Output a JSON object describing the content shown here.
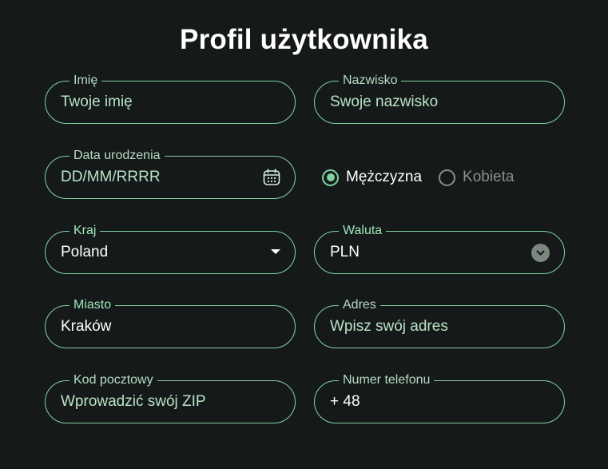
{
  "header": {
    "title": "Profil użytkownika"
  },
  "fields": {
    "first_name": {
      "label": "Imię",
      "placeholder": "Twoje imię"
    },
    "last_name": {
      "label": "Nazwisko",
      "placeholder": "Swoje nazwisko"
    },
    "birth_date": {
      "label": "Data urodzenia",
      "placeholder": "DD/MM/RRRR",
      "icon": "calendar-icon"
    },
    "country": {
      "label": "Kraj",
      "value": "Poland",
      "icon": "caret-down-icon"
    },
    "currency": {
      "label": "Waluta",
      "value": "PLN",
      "icon": "chevron-down-circle-icon"
    },
    "city": {
      "label": "Miasto",
      "value": "Kraków"
    },
    "address": {
      "label": "Adres",
      "placeholder": "Wpisz swój adres"
    },
    "zip": {
      "label": "Kod pocztowy",
      "placeholder": "Wprowadzić swój ZIP"
    },
    "phone": {
      "label": "Numer telefonu",
      "value": "+ 48"
    }
  },
  "gender": {
    "options": [
      {
        "label": "Mężczyzna",
        "selected": true
      },
      {
        "label": "Kobieta",
        "selected": false
      }
    ]
  },
  "colors": {
    "background": "#16191a",
    "accent": "#7fd3a2",
    "label": "#b3dcc3",
    "muted": "#8a8f8c"
  }
}
